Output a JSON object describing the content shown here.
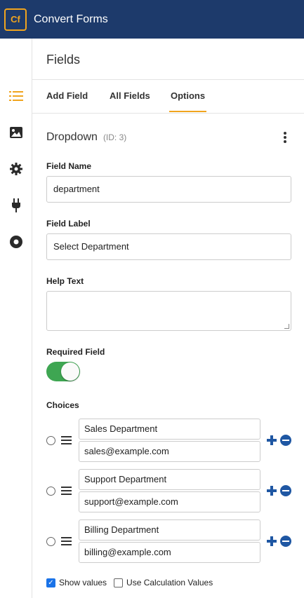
{
  "header": {
    "logo_text": "Cf",
    "app_title": "Convert Forms"
  },
  "colors": {
    "header_bg": "#1d3a6b",
    "accent": "#f0a41e",
    "toggle_on": "#3ea652",
    "action_blue": "#1f57a3"
  },
  "rail": {
    "icons": [
      "list-icon",
      "image-icon",
      "gear-icon",
      "plug-icon",
      "record-icon"
    ]
  },
  "panel": {
    "title": "Fields"
  },
  "tabs": [
    {
      "label": "Add Field"
    },
    {
      "label": "All Fields"
    },
    {
      "label": "Options",
      "active": true
    }
  ],
  "field": {
    "type": "Dropdown",
    "id_text": "(ID: 3)"
  },
  "form": {
    "field_name_label": "Field Name",
    "field_name_value": "department",
    "field_label_label": "Field Label",
    "field_label_value": "Select Department",
    "help_text_label": "Help Text",
    "help_text_value": "",
    "required_label": "Required Field",
    "required_on": true
  },
  "choices": {
    "label": "Choices",
    "items": [
      {
        "label": "Sales Department",
        "value": "sales@example.com"
      },
      {
        "label": "Support Department",
        "value": "support@example.com"
      },
      {
        "label": "Billing Department",
        "value": "billing@example.com"
      }
    ]
  },
  "options": {
    "show_values_label": "Show values",
    "show_values_checked": true,
    "calc_values_label": "Use Calculation Values",
    "calc_values_checked": false
  }
}
